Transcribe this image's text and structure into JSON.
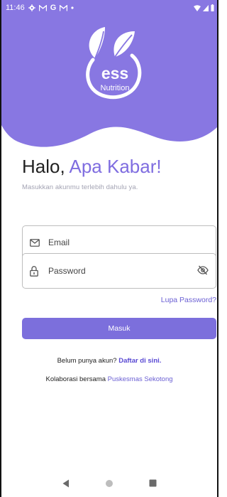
{
  "status_bar": {
    "time": "11:46",
    "left_icons": [
      "settings-gear-icon",
      "gmail-icon",
      "google-icon",
      "gmail-icon",
      "dot-icon"
    ],
    "right_icons": [
      "wifi-icon",
      "cell-signal-icon",
      "battery-icon"
    ]
  },
  "logo": {
    "text_main": "ess",
    "text_sub": "Nutrition"
  },
  "greeting": {
    "prefix": "Halo, ",
    "accent": "Apa Kabar!"
  },
  "subtext": "Masukkan akunmu terlebih dahulu ya.",
  "form": {
    "email_placeholder": "Email",
    "password_placeholder": "Password",
    "forgot_label": "Lupa Password?",
    "login_label": "Masuk"
  },
  "signup": {
    "prefix": "Belum punya akun? ",
    "link": "Daftar di sini."
  },
  "collab": {
    "prefix": "Kolaborasi bersama ",
    "link": "Puskesmas Sekotong"
  },
  "colors": {
    "primary": "#7c6fdc",
    "hero": "#8877e2",
    "link": "#5848d3"
  }
}
